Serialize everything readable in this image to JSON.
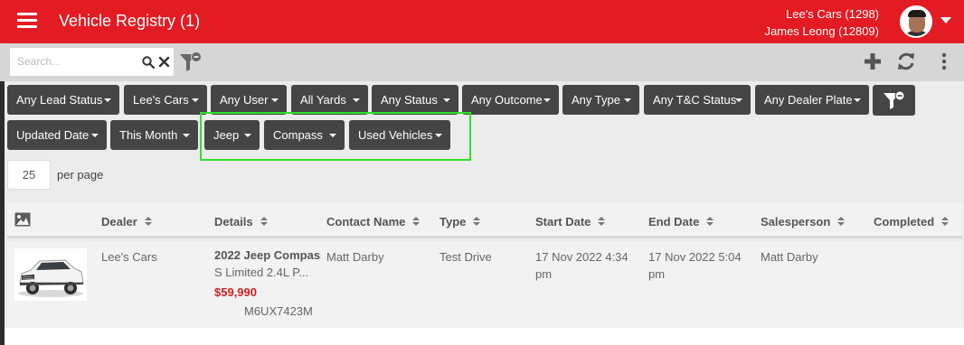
{
  "header": {
    "title": "Vehicle Registry (1)",
    "account_line1": "Lee's Cars (1298)",
    "account_line2": "James Leong (12809)",
    "brand_color": "#e31b23"
  },
  "search": {
    "placeholder": "Search...",
    "value": ""
  },
  "filters": {
    "row1": [
      "Any Lead Status",
      "Lee's Cars",
      "Any User",
      "All Yards",
      "Any Status",
      "Any Outcome",
      "Any Type",
      "Any T&C Status",
      "Any Dealer Plate"
    ],
    "row2": [
      "Updated Date",
      "This Month",
      "Jeep",
      "Compass",
      "Used Vehicles"
    ]
  },
  "pagination": {
    "per_page_value": "25",
    "per_page_label": "per page"
  },
  "table": {
    "columns": [
      "Dealer",
      "Details",
      "Contact Name",
      "Type",
      "Start Date",
      "End Date",
      "Salesperson",
      "Completed"
    ],
    "rows": [
      {
        "dealer": "Lee's Cars",
        "details_title": "2022 Jeep Compass",
        "details_sub": "S Limited 2.4L P...",
        "price": "$59,990",
        "rego": "M6UX7423M",
        "contact": "Matt Darby",
        "type": "Test Drive",
        "start_date": "17 Nov 2022 4:34 pm",
        "end_date": "17 Nov 2022 5:04 pm",
        "salesperson": "Matt Darby",
        "completed": ""
      }
    ]
  },
  "icons": [
    "hamburger-menu-icon",
    "search-icon",
    "clear-icon",
    "filter-clear-icon",
    "add-icon",
    "refresh-icon",
    "more-vert-icon",
    "image-icon",
    "sort-icon"
  ]
}
